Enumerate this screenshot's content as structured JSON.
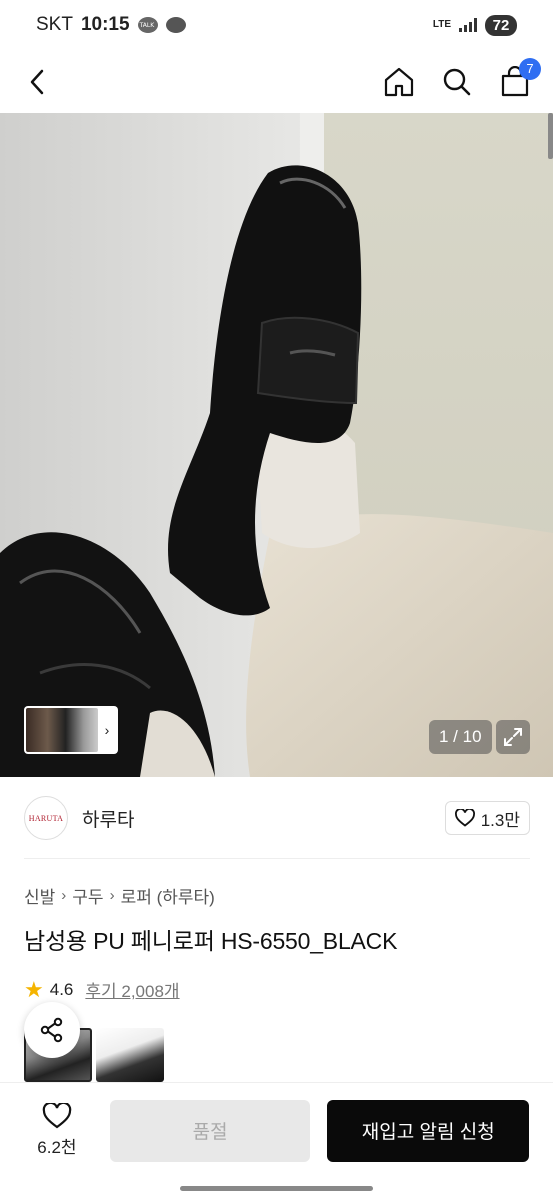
{
  "status_bar": {
    "carrier": "SKT",
    "time": "10:15",
    "network": "LTE",
    "battery": "72"
  },
  "nav": {
    "cart_count": "7"
  },
  "gallery": {
    "counter": "1 / 10"
  },
  "brand": {
    "logo_text": "HARUTA",
    "name": "하루타",
    "likes": "1.3만"
  },
  "breadcrumb": [
    "신발",
    "구두",
    "로퍼 (하루타)"
  ],
  "product": {
    "title": "남성용 PU 페니로퍼 HS-6550_BLACK",
    "rating": "4.6",
    "reviews": "후기 2,008개"
  },
  "bottom_bar": {
    "wish_count": "6.2천",
    "soldout_label": "품절",
    "restock_label": "재입고 알림 신청"
  },
  "colors": {
    "accent_blue": "#2f6ef2",
    "star": "#f5b400",
    "primary_button": "#0a0a0a",
    "disabled_button": "#e8e8e8"
  }
}
